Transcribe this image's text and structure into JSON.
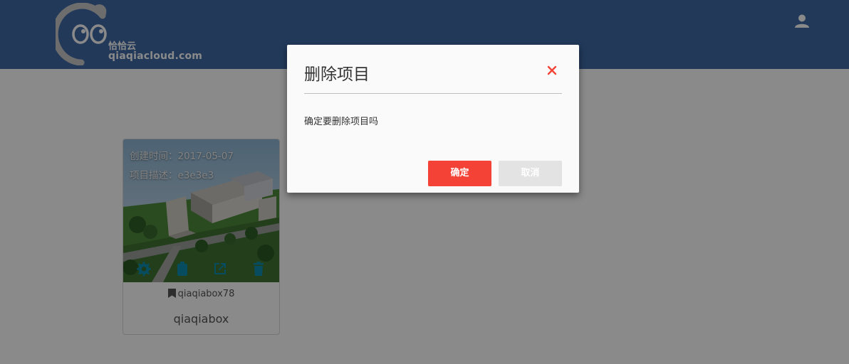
{
  "header": {
    "logo_cn": "恰恰云",
    "logo_en": "qiaqiacloud.com",
    "user_icon": "person-icon",
    "background": "#3f6aa6"
  },
  "project_card": {
    "created_label": "创建时间：2017-05-07",
    "description_label": "项目描述：e3e3e3",
    "actions": [
      "gear-icon",
      "clipboard-icon",
      "open-external-icon",
      "trash-icon"
    ],
    "action_color": "#0d8fb0",
    "owner": "qiaqiabox78",
    "owner_icon": "bookmark-icon",
    "title": "qiaqiabox"
  },
  "modal": {
    "title": "删除项目",
    "message": "确定要删除项目吗",
    "confirm_label": "确定",
    "cancel_label": "取消",
    "close_icon": "close-icon",
    "confirm_color": "#f44336",
    "cancel_color": "#e3e3e3"
  }
}
